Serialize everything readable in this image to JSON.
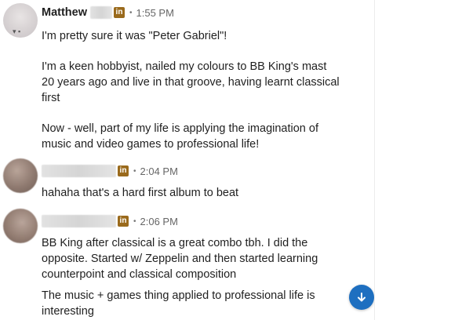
{
  "messages": [
    {
      "sender": "Matthew",
      "badge": "in",
      "separator": "•",
      "time": "1:55 PM",
      "paragraphs": [
        "I'm pretty sure it was \"Peter Gabriel\"!",
        "I'm a keen hobbyist, nailed my colours to BB King's mast 20 years ago and live in that groove, having learnt classical first",
        "Now - well, part of my life is applying the imagination of music and video games to professional life!"
      ]
    },
    {
      "sender": "",
      "badge": "in",
      "separator": "•",
      "time": "2:04 PM",
      "paragraphs": [
        "hahaha that's a hard first album to beat"
      ]
    },
    {
      "sender": "",
      "badge": "in",
      "separator": "•",
      "time": "2:06 PM",
      "paragraphs": [
        "BB King after classical is a great combo tbh. I did the opposite. Started w/ Zeppelin and then started learning counterpoint and classical composition",
        "The music + games thing applied to professional life is interesting"
      ]
    }
  ],
  "icons": {
    "scroll_down": "arrow-down-icon",
    "linkedin": "linkedin-icon"
  },
  "colors": {
    "accent": "#1e6fc0",
    "badge": "#9a6a1c"
  }
}
